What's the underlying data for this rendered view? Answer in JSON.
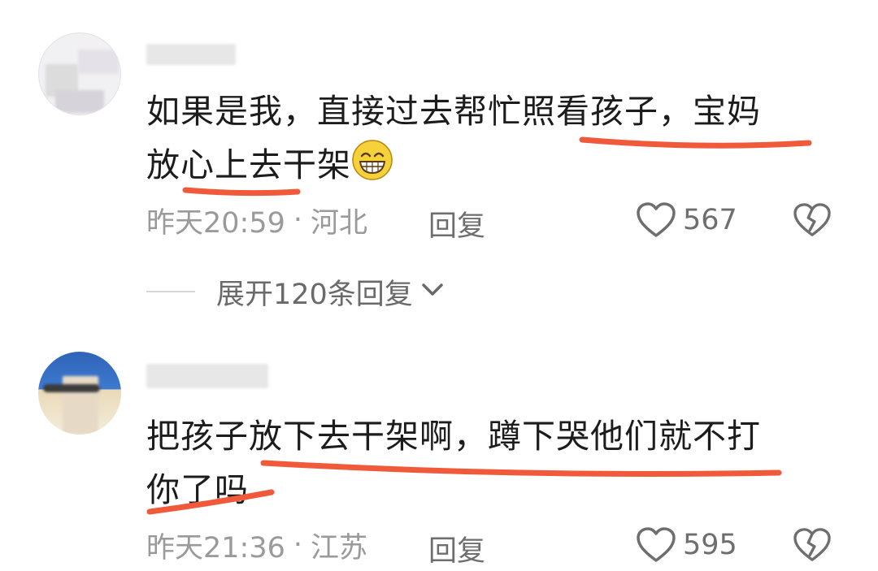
{
  "comments": [
    {
      "text_line1": "如果是我，直接过去帮忙照看孩子，宝妈",
      "text_line2": "放心上去干架",
      "emoji": "grinning-face-emoji",
      "time": "昨天20:59",
      "separator": "·",
      "location": "河北",
      "reply_label": "回复",
      "likes": "567",
      "expand_label": "展开120条回复",
      "underline_color": "#f05a3a"
    },
    {
      "text_line1": "把孩子放下去干架啊，蹲下哭他们就不打",
      "text_line2": "你了吗",
      "time": "昨天21:36",
      "separator": "·",
      "location": "江苏",
      "reply_label": "回复",
      "likes": "595",
      "underline_color": "#f05a3a"
    }
  ],
  "icons": {
    "like": "heart-outline-icon",
    "dislike": "broken-heart-icon",
    "expand": "chevron-down-icon"
  },
  "colors": {
    "text": "#1c1c1c",
    "meta": "#9a9a9a",
    "action": "#6e6e6e",
    "highlight": "#f05a3a"
  }
}
